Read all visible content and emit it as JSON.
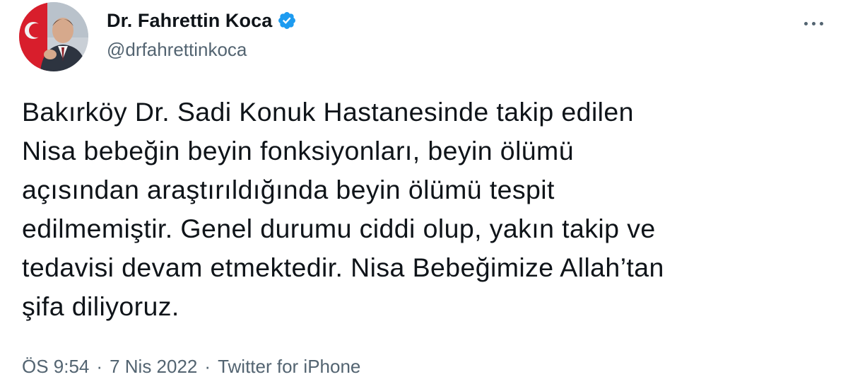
{
  "author": {
    "display_name": "Dr. Fahrettin Koca",
    "handle": "@drfahrettinkoca",
    "verified": true,
    "verified_color": "#1d9bf0"
  },
  "tweet": {
    "lines": [
      "Bakırköy Dr. Sadi Konuk Hastanesinde takip edilen",
      "Nisa bebeğin beyin fonksiyonları, beyin ölümü",
      "açısından araştırıldığında beyin ölümü tespit",
      "edilmemiştir. Genel durumu ciddi olup, yakın takip ve",
      "tedavisi devam etmektedir. Nisa Bebeğimize Allah’tan",
      "şifa diliyoruz."
    ]
  },
  "meta": {
    "time": "ÖS 9:54",
    "separator": "·",
    "date": "7 Nis 2022",
    "source": "Twitter for iPhone"
  },
  "icons": {
    "more": "more-horizontal-icon",
    "verified": "verified-badge-icon"
  }
}
